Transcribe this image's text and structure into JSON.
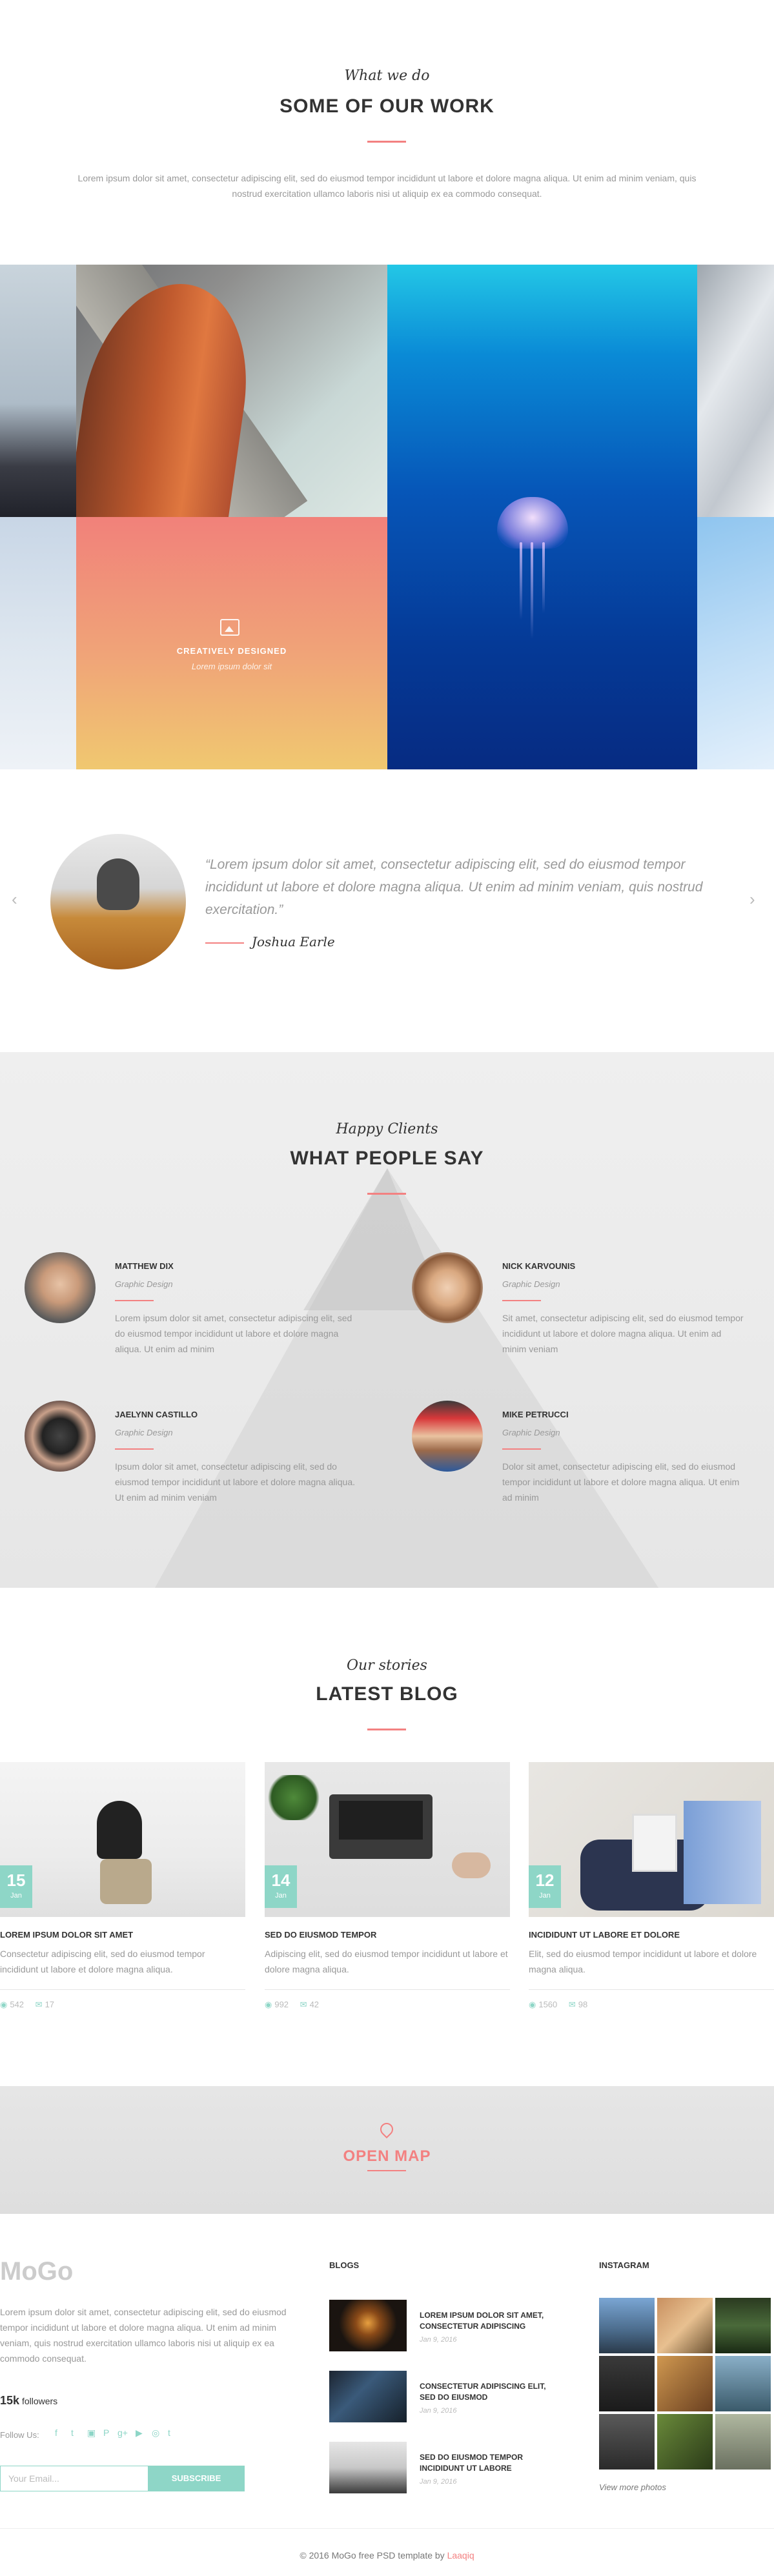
{
  "work": {
    "script_title": "What we do",
    "title": "SOME OF OUR WORK",
    "lead": "Lorem ipsum dolor sit amet, consectetur adipiscing elit, sed do eiusmod tempor incididunt ut labore et dolore magna aliqua. Ut enim ad minim veniam, quis nostrud exercitation ullamco laboris nisi ut aliquip ex ea commodo consequat.",
    "overlay": {
      "title": "CREATIVELY DESIGNED",
      "subtitle": "Lorem ipsum dolor sit"
    }
  },
  "quote": {
    "text": "“Lorem ipsum dolor sit amet, consectetur adipiscing elit, sed do eiusmod tempor incididunt ut labore et dolore magna aliqua. Ut enim ad minim veniam, quis nostrud exercitation.”",
    "author": "Joshua Earle",
    "prev": "‹",
    "next": "›"
  },
  "clients": {
    "script_title": "Happy Clients",
    "title": "WHAT PEOPLE SAY",
    "items": [
      {
        "name": "MATTHEW DIX",
        "role": "Graphic Design",
        "text": "Lorem ipsum dolor sit amet, consectetur adipiscing elit, sed do eiusmod tempor incididunt ut labore et dolore magna aliqua. Ut enim ad minim"
      },
      {
        "name": "NICK KARVOUNIS",
        "role": "Graphic Design",
        "text": "Sit amet, consectetur adipiscing elit, sed do eiusmod tempor incididunt ut labore et dolore magna aliqua. Ut enim ad minim veniam"
      },
      {
        "name": "JAELYNN CASTILLO",
        "role": "Graphic Design",
        "text": "Ipsum dolor sit amet, consectetur adipiscing elit, sed do eiusmod tempor incididunt ut labore et dolore magna aliqua. Ut enim ad minim veniam"
      },
      {
        "name": "MIKE PETRUCCI",
        "role": "Graphic Design",
        "text": "Dolor sit amet, consectetur adipiscing elit, sed do eiusmod tempor incididunt ut labore et dolore magna aliqua. Ut enim ad minim"
      }
    ]
  },
  "blog": {
    "script_title": "Our stories",
    "title": "LATEST BLOG",
    "posts": [
      {
        "day": "15",
        "month": "Jan",
        "title": "LOREM IPSUM DOLOR SIT AMET",
        "excerpt": "Consectetur adipiscing elit, sed do eiusmod tempor incididunt ut labore et dolore magna aliqua.",
        "views": "542",
        "comments": "17"
      },
      {
        "day": "14",
        "month": "Jan",
        "title": "SED DO EIUSMOD TEMPOR",
        "excerpt": "Adipiscing elit, sed do eiusmod tempor incididunt ut labore et dolore magna aliqua.",
        "views": "992",
        "comments": "42"
      },
      {
        "day": "12",
        "month": "Jan",
        "title": "INCIDIDUNT UT LABORE ET DOLORE",
        "excerpt": "Elit, sed do eiusmod tempor incididunt ut labore et dolore magna aliqua.",
        "views": "1560",
        "comments": "98"
      }
    ]
  },
  "map": {
    "label": "OPEN MAP"
  },
  "footer": {
    "logo": "MoGo",
    "about": "Lorem ipsum dolor sit amet, consectetur adipiscing elit, sed do eiusmod tempor incididunt ut labore et dolore magna aliqua. Ut enim ad minim veniam, quis nostrud exercitation ullamco laboris nisi ut aliquip ex ea commodo consequat.",
    "followers_count": "15k",
    "followers_label": "followers",
    "follow_us": "Follow Us:",
    "social_icons": [
      "f",
      "t",
      "▣",
      "P",
      "g+",
      "▶",
      "◎",
      "t"
    ],
    "email_placeholder": "Your Email...",
    "subscribe": "SUBSCRIBE",
    "blogs_heading": "BLOGS",
    "blogs": [
      {
        "title": "LOREM IPSUM DOLOR SIT AMET, CONSECTETUR ADIPISCING",
        "date": "Jan 9, 2016"
      },
      {
        "title": "CONSECTETUR ADIPISCING ELIT, SED DO EIUSMOD",
        "date": "Jan 9, 2016"
      },
      {
        "title": "SED DO EIUSMOD TEMPOR INCIDIDUNT UT LABORE",
        "date": "Jan 9, 2016"
      }
    ],
    "instagram_heading": "INSTAGRAM",
    "view_more": "View more photos",
    "copyright_prefix": "© 2016 MoGo free PSD template by",
    "copyright_author": "Laaqiq"
  }
}
